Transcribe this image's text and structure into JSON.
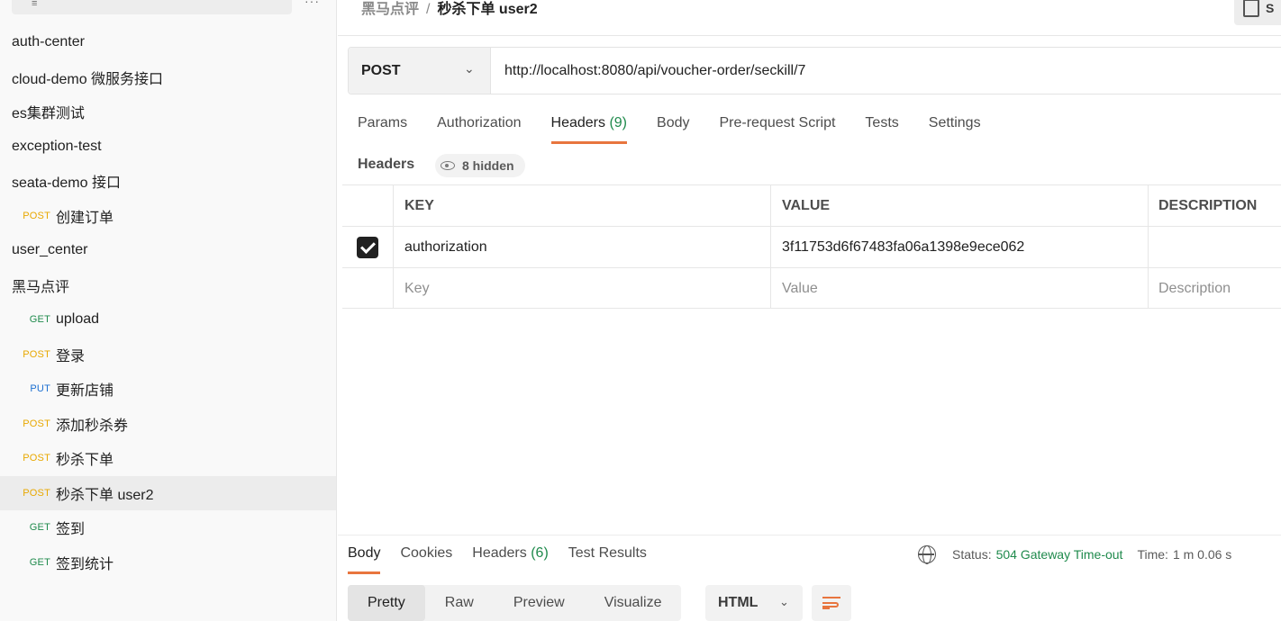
{
  "sidebar": {
    "items": [
      {
        "kind": "folder",
        "label": "auth-center"
      },
      {
        "kind": "folder",
        "label": "cloud-demo 微服务接口"
      },
      {
        "kind": "folder",
        "label": "es集群测试"
      },
      {
        "kind": "folder",
        "label": "exception-test"
      },
      {
        "kind": "folder",
        "label": "seata-demo 接口"
      },
      {
        "kind": "request",
        "method": "POST",
        "label": "创建订单"
      },
      {
        "kind": "folder",
        "label": "user_center"
      },
      {
        "kind": "folder",
        "label": "黑马点评"
      },
      {
        "kind": "request",
        "method": "GET",
        "label": "upload"
      },
      {
        "kind": "request",
        "method": "POST",
        "label": "登录"
      },
      {
        "kind": "request",
        "method": "PUT",
        "label": "更新店铺"
      },
      {
        "kind": "request",
        "method": "POST",
        "label": "添加秒杀券"
      },
      {
        "kind": "request",
        "method": "POST",
        "label": "秒杀下单"
      },
      {
        "kind": "request",
        "method": "POST",
        "label": "秒杀下单 user2",
        "active": true
      },
      {
        "kind": "request",
        "method": "GET",
        "label": "签到"
      },
      {
        "kind": "request",
        "method": "GET",
        "label": "签到统计"
      }
    ]
  },
  "breadcrumb": {
    "parent": "黑马点评",
    "separator": "/",
    "current": "秒杀下单 user2"
  },
  "toolbar": {
    "save_label": "S"
  },
  "request": {
    "method": "POST",
    "url": "http://localhost:8080/api/voucher-order/seckill/7"
  },
  "request_tabs": [
    {
      "label": "Params"
    },
    {
      "label": "Authorization"
    },
    {
      "label": "Headers",
      "count": "(9)",
      "active": true
    },
    {
      "label": "Body"
    },
    {
      "label": "Pre-request Script"
    },
    {
      "label": "Tests"
    },
    {
      "label": "Settings"
    }
  ],
  "headers_section": {
    "label": "Headers",
    "hidden_count": "8 hidden"
  },
  "headers_table": {
    "columns": {
      "key": "KEY",
      "value": "VALUE",
      "description": "DESCRIPTION"
    },
    "rows": [
      {
        "checked": true,
        "key": "authorization",
        "value": "3f11753d6f67483fa06a1398e9ece062",
        "description": ""
      }
    ],
    "placeholders": {
      "key": "Key",
      "value": "Value",
      "description": "Description"
    }
  },
  "response_tabs": [
    {
      "label": "Body",
      "active": true
    },
    {
      "label": "Cookies"
    },
    {
      "label": "Headers",
      "count": "(6)"
    },
    {
      "label": "Test Results"
    }
  ],
  "response_status": {
    "status_label": "Status:",
    "status_value": "504 Gateway Time-out",
    "time_label": "Time:",
    "time_value": "1 m 0.06 s"
  },
  "response_format": {
    "options": [
      "Pretty",
      "Raw",
      "Preview",
      "Visualize"
    ],
    "selected": "Pretty",
    "language": "HTML"
  },
  "colors": {
    "accent": "#e8753e",
    "post": "#e8a800",
    "get": "#1f8a4c",
    "put": "#1c6fd1",
    "status_ok_text": "#1f8a4c"
  }
}
